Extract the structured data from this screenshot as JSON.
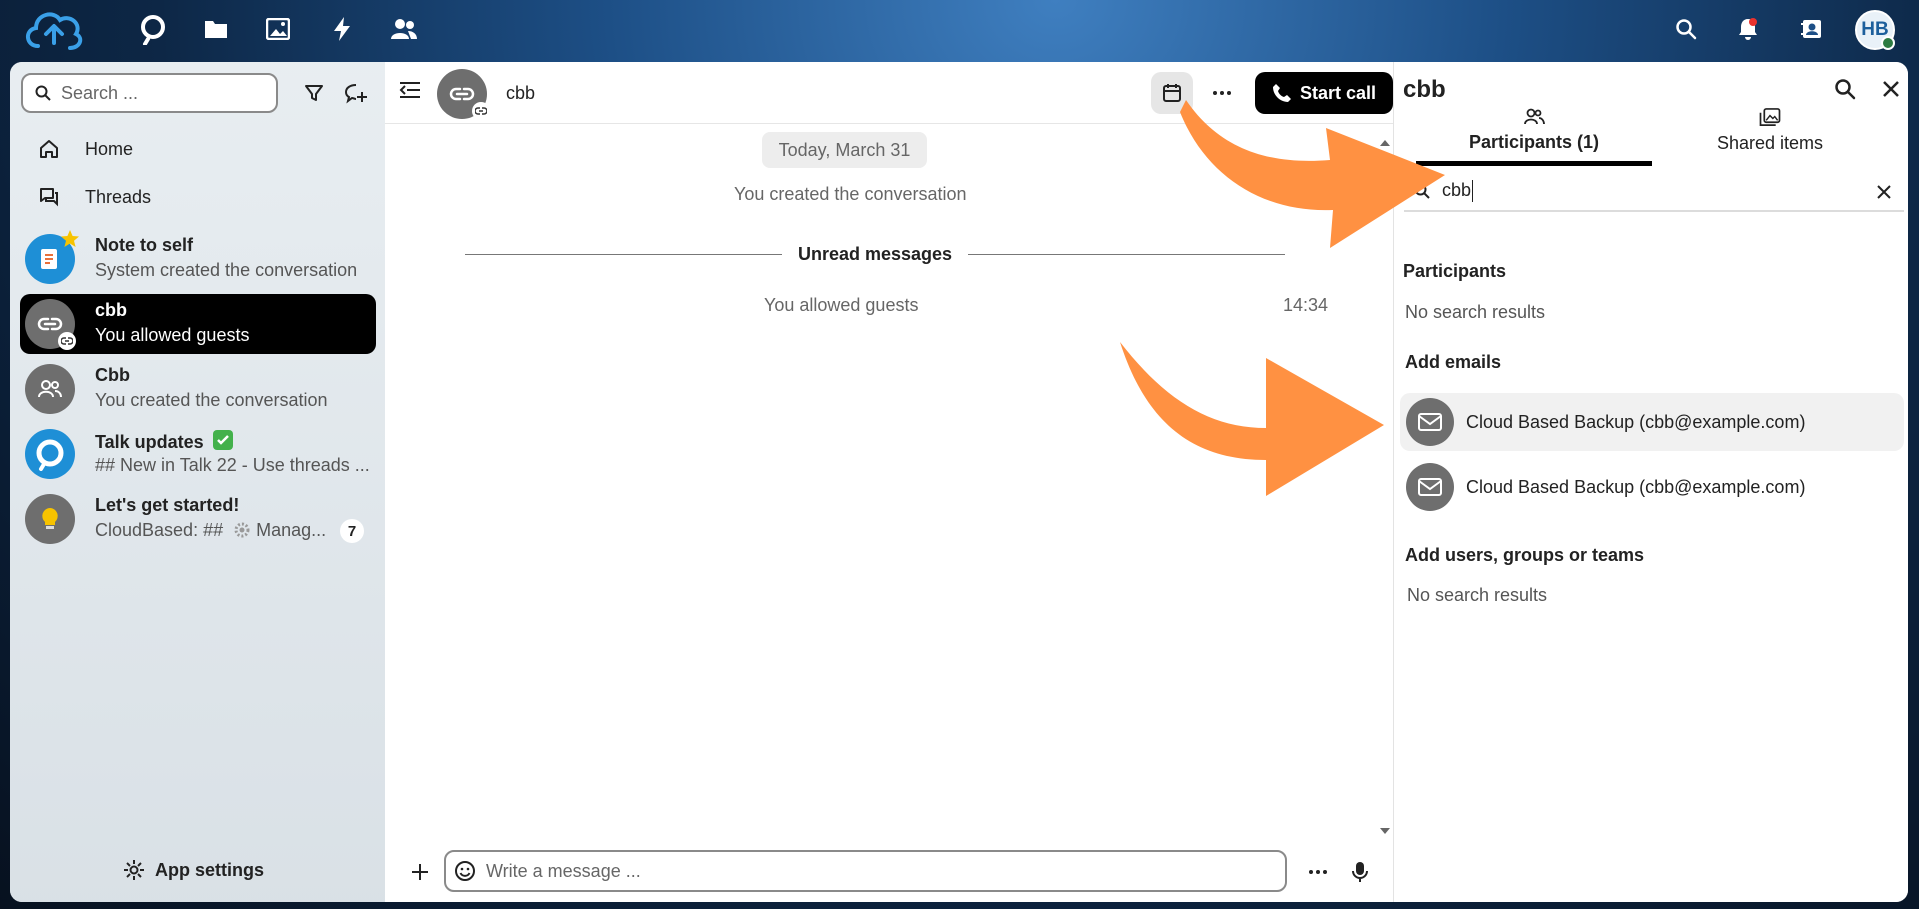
{
  "topbar": {
    "apps": [
      "talk-icon",
      "files-icon",
      "photos-icon",
      "activity-icon",
      "contacts-icon"
    ],
    "right_icons": [
      "search-icon",
      "notifications-icon",
      "contacts-menu-icon"
    ],
    "user_initials": "HB"
  },
  "sidebar": {
    "search_placeholder": "Search ...",
    "nav": [
      {
        "label": "Home"
      },
      {
        "label": "Threads"
      }
    ],
    "conversations": [
      {
        "name": "Note to self",
        "message": "System created the conversation"
      },
      {
        "name": "cbb",
        "message": "You allowed guests"
      },
      {
        "name": "Cbb",
        "message": "You created the conversation"
      },
      {
        "name": "Talk updates",
        "message": "## New in Talk 22 - Use threads ..."
      },
      {
        "name": "Let's get started!",
        "message": "CloudBased: ##",
        "message_tail": "Manag...",
        "badge": "7"
      }
    ],
    "app_settings": "App settings"
  },
  "chat": {
    "title": "cbb",
    "start_call": "Start call",
    "date": "Today, March 31",
    "created_msg": "You created the conversation",
    "unread_label": "Unread messages",
    "allowed_msg": "You allowed guests",
    "allowed_time": "14:34",
    "composer_placeholder": "Write a message ..."
  },
  "panel": {
    "title": "cbb",
    "tabs": [
      {
        "label": "Participants (1)"
      },
      {
        "label": "Shared items"
      }
    ],
    "search_value": "cbb",
    "participants_heading": "Participants",
    "participants_empty": "No search results",
    "emails_heading": "Add emails",
    "emails": [
      {
        "label": "Cloud Based Backup (cbb@example.com)"
      },
      {
        "label": "Cloud Based Backup (cbb@example.com)"
      }
    ],
    "users_heading": "Add users, groups or teams",
    "users_empty": "No search results"
  },
  "colors": {
    "accent_dark": "#000000",
    "annotation_arrow": "#ff9142",
    "status_online": "#2d7b41"
  }
}
